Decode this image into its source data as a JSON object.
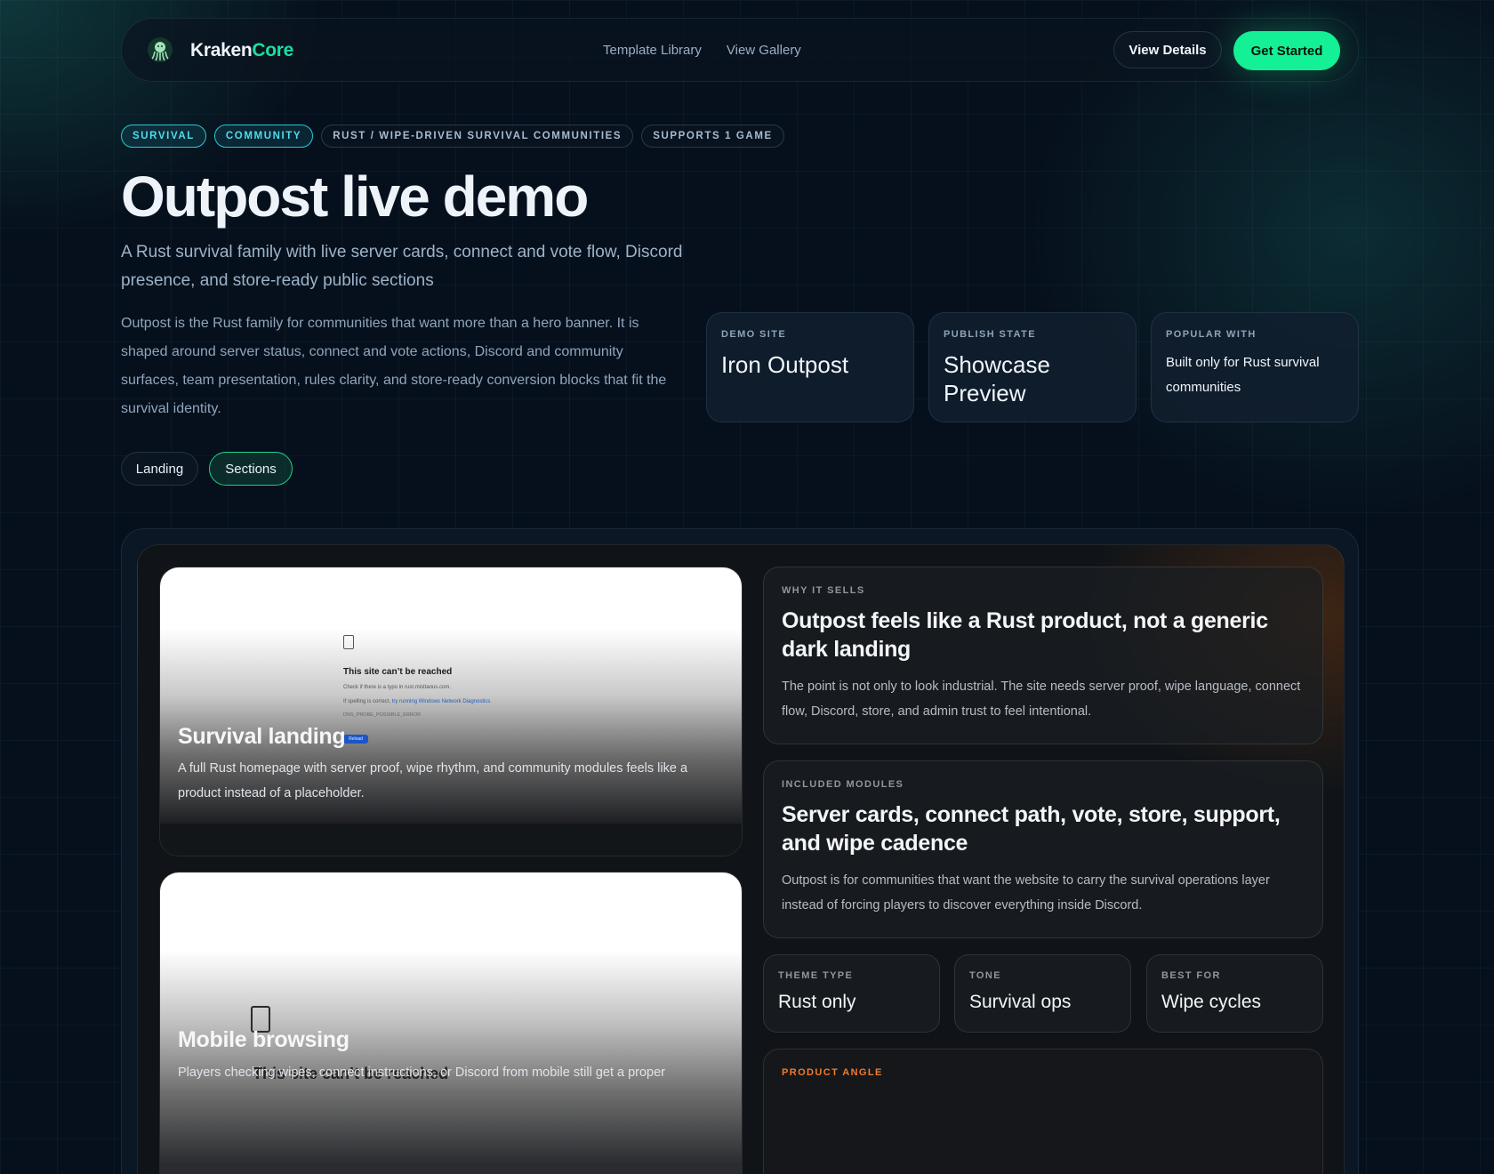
{
  "nav": {
    "brand_part1": "Kraken",
    "brand_part2": "Core",
    "links": [
      "Template Library",
      "View Gallery"
    ],
    "view_details": "View Details",
    "get_started": "Get Started"
  },
  "tags": [
    "SURVIVAL",
    "COMMUNITY",
    "RUST / WIPE-DRIVEN SURVIVAL COMMUNITIES",
    "SUPPORTS 1 GAME"
  ],
  "hero": {
    "title": "Outpost live demo",
    "subtitle": "A Rust survival family with live server cards, connect and vote flow, Discord presence, and store-ready public sections",
    "description": "Outpost is the Rust family for communities that want more than a hero banner. It is shaped around server status, connect and vote actions, Discord and community surfaces, team presentation, rules clarity, and store-ready conversion blocks that fit the survival identity."
  },
  "stats": [
    {
      "label": "DEMO SITE",
      "value": "Iron Outpost"
    },
    {
      "label": "PUBLISH STATE",
      "value": "Showcase Preview"
    },
    {
      "label": "POPULAR WITH",
      "value": "Built only for Rust survival communities"
    }
  ],
  "view_toggle": {
    "landing": "Landing",
    "sections": "Sections",
    "selected": "Sections"
  },
  "showcase": {
    "card1": {
      "error_title": "This site can’t be reached",
      "error_line1": "Check if there is a typo in rust.misttanus.com.",
      "error_line2_pre": "If spelling is correct, ",
      "error_line2_link": "try running Windows Network Diagnostics",
      "error_code": "DNS_PROBE_POSSIBLE_ERROR",
      "reload": "Reload",
      "title": "Survival landing",
      "text": "A full Rust homepage with server proof, wipe rhythm, and community modules feels like a product instead of a placeholder."
    },
    "card2": {
      "error_title": "This site can’t be reached",
      "title": "Mobile browsing",
      "text": "Players checking wipes, connect instructions, or Discord from mobile still get a proper"
    },
    "why": {
      "label": "WHY IT SELLS",
      "title": "Outpost feels like a Rust product, not a generic dark landing",
      "text": "The point is not only to look industrial. The site needs server proof, wipe language, connect flow, Discord, store, and admin trust to feel intentional."
    },
    "modules": {
      "label": "INCLUDED MODULES",
      "title": "Server cards, connect path, vote, store, support, and wipe cadence",
      "text": "Outpost is for communities that want the website to carry the survival operations layer instead of forcing players to discover everything inside Discord."
    },
    "facts": [
      {
        "label": "THEME TYPE",
        "value": "Rust only"
      },
      {
        "label": "TONE",
        "value": "Survival ops"
      },
      {
        "label": "BEST FOR",
        "value": "Wipe cycles"
      }
    ],
    "angle": {
      "label": "PRODUCT ANGLE"
    }
  },
  "colors": {
    "accent": "#14f095",
    "cyan": "#4fdcec",
    "orange": "#f07a2e",
    "bg": "#06101c"
  }
}
